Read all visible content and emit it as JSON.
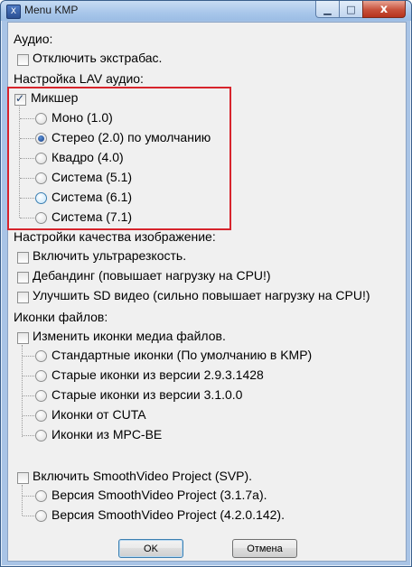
{
  "window": {
    "title": "Menu KMP",
    "icon": "kmp-app-icon",
    "close_glyph": "x"
  },
  "sections": {
    "audio": {
      "header": "Аудио:",
      "disable_extrabass": {
        "label": "Отключить экстрабас.",
        "checked": false
      }
    },
    "lav_audio": {
      "header": "Настройка LAV аудио:",
      "mixer": {
        "label": "Микшер",
        "checked": true
      },
      "options": [
        {
          "label": "Моно (1.0)",
          "selected": false
        },
        {
          "label": "Стерео (2.0) по умолчанию",
          "selected": true
        },
        {
          "label": "Квадро (4.0)",
          "selected": false
        },
        {
          "label": "Система (5.1)",
          "selected": false
        },
        {
          "label": "Система (6.1)",
          "selected": false
        },
        {
          "label": "Система (7.1)",
          "selected": false
        }
      ],
      "highlight_color": "#d7242c"
    },
    "image_quality": {
      "header": "Настройки качества изображение:",
      "options": [
        {
          "label": "Включить ультрарезкость.",
          "checked": false
        },
        {
          "label": "Дебандинг (повышает нагрузку на CPU!)",
          "checked": false
        },
        {
          "label": "Улучшить SD видео (сильно повышает нагрузку на CPU!)",
          "checked": false
        }
      ]
    },
    "file_icons": {
      "header": "Иконки файлов:",
      "change_icons": {
        "label": "Изменить иконки медиа файлов.",
        "checked": false
      },
      "options": [
        {
          "label": "Стандартные иконки (По умолчанию в KMP)",
          "selected": false
        },
        {
          "label": "Старые иконки из версии 2.9.3.1428",
          "selected": false
        },
        {
          "label": "Старые иконки из версии 3.1.0.0",
          "selected": false
        },
        {
          "label": "Иконки от CUTA",
          "selected": false
        },
        {
          "label": "Иконки из MPC-BE",
          "selected": false
        }
      ]
    },
    "svp": {
      "enable": {
        "label": "Включить SmoothVideo Project (SVP).",
        "checked": false
      },
      "options": [
        {
          "label": "Версия SmoothVideo Project (3.1.7a).",
          "selected": false
        },
        {
          "label": "Версия SmoothVideo Project (4.2.0.142).",
          "selected": false
        }
      ]
    }
  },
  "buttons": {
    "ok": "OK",
    "cancel": "Отмена"
  }
}
